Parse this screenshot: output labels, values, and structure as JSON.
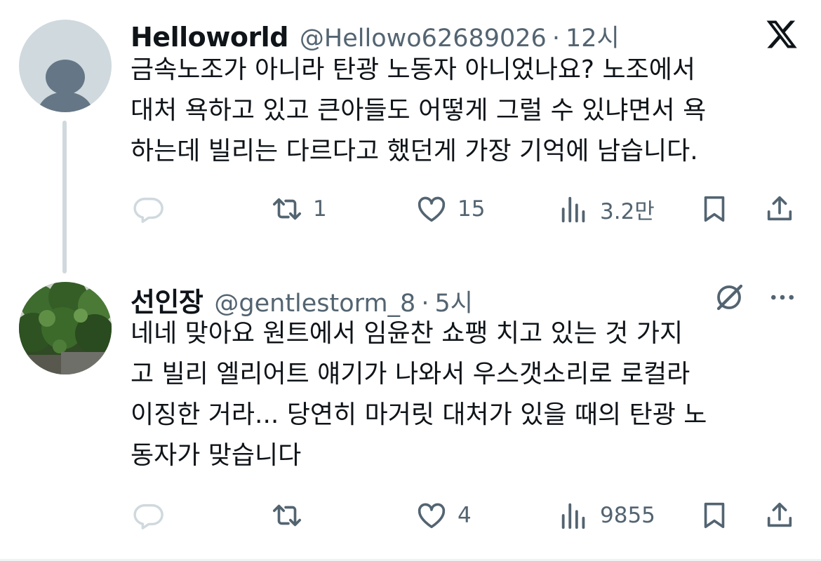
{
  "tweets": [
    {
      "name": "Helloworld",
      "handle": "@Hellowo62689026",
      "separator": "·",
      "time": "12시",
      "text": "금속노조가 아니라 탄광 노동자 아니었나요?  노조에서\n대처 욕하고 있고 큰아들도 어떻게 그럴 수 있냐면서 욕\n하는데 빌리는 다르다고 했던게 가장 기억에 남습니다.",
      "avatar": "default-profile-icon",
      "actions": {
        "reply": "",
        "retweet": "1",
        "like": "15",
        "views": "3.2만"
      }
    },
    {
      "name": "선인장",
      "handle": "@gentlestorm_8",
      "separator": "·",
      "time": "5시",
      "text": "네네 맞아요 원트에서 임윤찬 쇼팽 치고 있는 것 가지\n고 빌리 엘리어트 얘기가 나와서 우스갯소리로 로컬라\n이징한 거라... 당연히 마거릿 대처가 있을 때의 탄광 노\n동자가 맞습니다",
      "avatar": "foliage-photo",
      "actions": {
        "reply": "",
        "retweet": "",
        "like": "4",
        "views": "9855"
      }
    }
  ],
  "icons": {
    "brand": "x-logo-icon",
    "grok": "grok-icon",
    "more": "more-dots-icon",
    "reply": "reply-icon",
    "retweet": "retweet-icon",
    "like": "heart-icon",
    "views": "views-icon",
    "bookmark": "bookmark-icon",
    "share": "share-icon"
  },
  "colors": {
    "text": "#0f1419",
    "secondary": "#536471",
    "reply_icon": "#cfd9de",
    "thread_line": "#cfd9de",
    "avatar_bg": "#cfd9de",
    "avatar_fg": "#657786"
  }
}
